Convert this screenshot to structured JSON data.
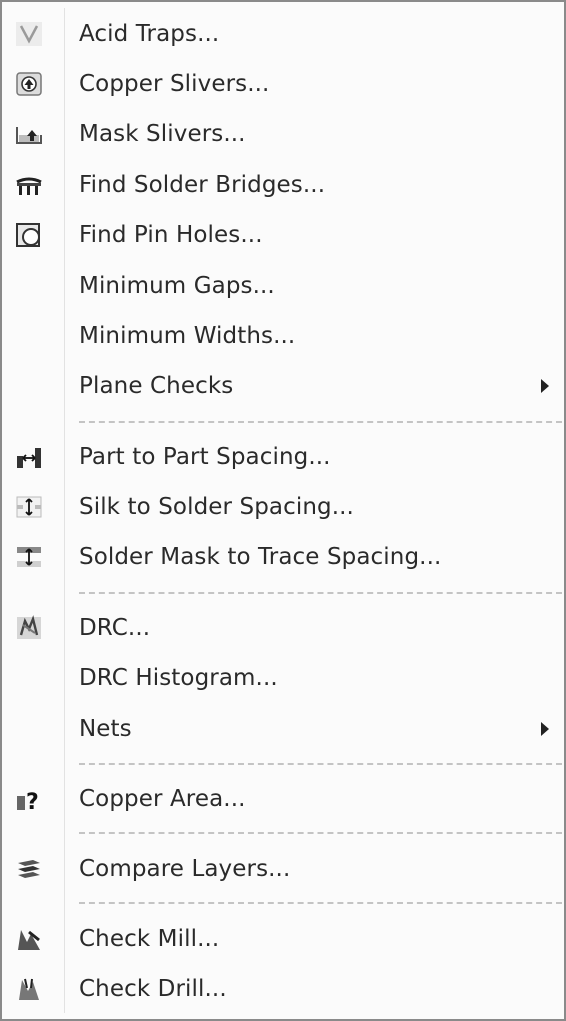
{
  "menu": {
    "items": [
      {
        "label": "Acid Traps...",
        "icon": "acid-traps-icon"
      },
      {
        "label": "Copper Slivers...",
        "icon": "copper-slivers-icon"
      },
      {
        "label": "Mask Slivers...",
        "icon": "mask-slivers-icon"
      },
      {
        "label": "Find Solder Bridges...",
        "icon": "solder-bridges-icon"
      },
      {
        "label": "Find Pin Holes...",
        "icon": "pin-holes-icon"
      },
      {
        "label": "Minimum Gaps...",
        "icon": ""
      },
      {
        "label": "Minimum Widths...",
        "icon": ""
      },
      {
        "label": "Plane Checks",
        "icon": "",
        "submenu": true
      },
      {
        "label": "Part to Part Spacing...",
        "icon": "part-spacing-icon"
      },
      {
        "label": "Silk to Solder Spacing...",
        "icon": "silk-spacing-icon"
      },
      {
        "label": "Solder Mask to Trace Spacing...",
        "icon": "mask-trace-spacing-icon"
      },
      {
        "label": "DRC...",
        "icon": "drc-icon"
      },
      {
        "label": "DRC Histogram...",
        "icon": ""
      },
      {
        "label": "Nets",
        "icon": "",
        "submenu": true
      },
      {
        "label": "Copper Area...",
        "icon": "copper-area-icon"
      },
      {
        "label": "Compare Layers...",
        "icon": "compare-layers-icon"
      },
      {
        "label": "Check Mill...",
        "icon": "check-mill-icon"
      },
      {
        "label": "Check Drill...",
        "icon": "check-drill-icon"
      }
    ]
  }
}
